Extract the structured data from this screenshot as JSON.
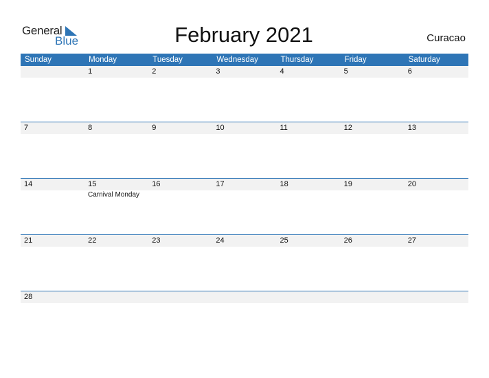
{
  "logo": {
    "word1": "General",
    "word2": "Blue"
  },
  "title": "February 2021",
  "country": "Curacao",
  "colors": {
    "accent": "#2e75b6",
    "strip": "#f2f2f2"
  },
  "weekdays": [
    "Sunday",
    "Monday",
    "Tuesday",
    "Wednesday",
    "Thursday",
    "Friday",
    "Saturday"
  ],
  "weeks": [
    {
      "days": [
        "",
        "1",
        "2",
        "3",
        "4",
        "5",
        "6"
      ]
    },
    {
      "days": [
        "7",
        "8",
        "9",
        "10",
        "11",
        "12",
        "13"
      ]
    },
    {
      "days": [
        "14",
        "15",
        "16",
        "17",
        "18",
        "19",
        "20"
      ],
      "events": [
        {
          "day": "15",
          "label": "Carnival Monday"
        }
      ]
    },
    {
      "days": [
        "21",
        "22",
        "23",
        "24",
        "25",
        "26",
        "27"
      ]
    },
    {
      "days": [
        "28",
        "",
        "",
        "",
        "",
        "",
        ""
      ]
    }
  ]
}
